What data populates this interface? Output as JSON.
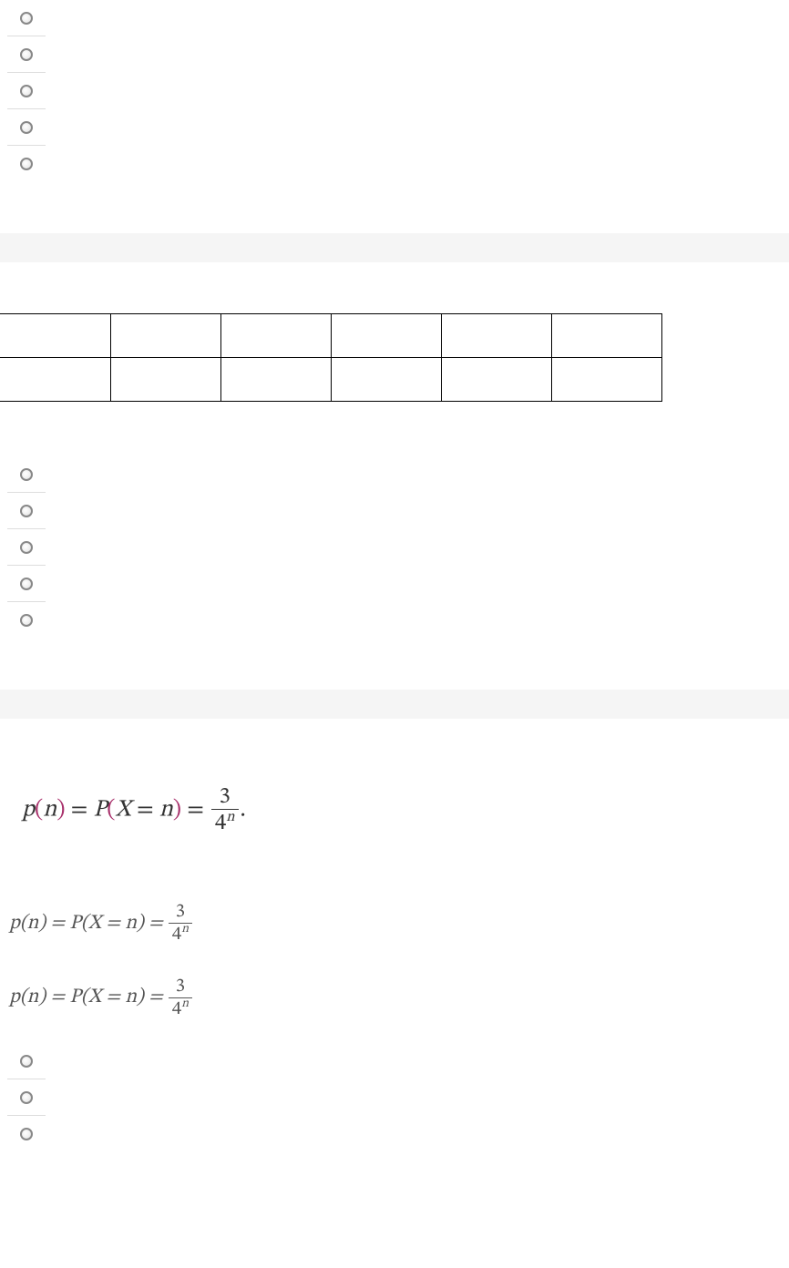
{
  "radio_groups": {
    "g1": [
      {
        "id": "r1"
      },
      {
        "id": "r2"
      },
      {
        "id": "r3"
      },
      {
        "id": "r4"
      },
      {
        "id": "r5"
      }
    ],
    "g2": [
      {
        "id": "r6"
      },
      {
        "id": "r7"
      },
      {
        "id": "r8"
      },
      {
        "id": "r9"
      },
      {
        "id": "r10"
      }
    ],
    "g3": [
      {
        "id": "r11"
      },
      {
        "id": "r12"
      },
      {
        "id": "r13"
      }
    ]
  },
  "table": {
    "rows": [
      {
        "cells": [
          "",
          "",
          "",
          "",
          "",
          ""
        ]
      },
      {
        "cells": [
          "",
          "",
          "",
          "",
          "",
          ""
        ]
      }
    ]
  },
  "math": {
    "primary": {
      "lhs_p": "p",
      "lparen": "(",
      "n": "n",
      "rparen": ")",
      "eq": " = ",
      "capP": "P",
      "lparen2": "(",
      "X": "X",
      "eqn": " = ",
      "n2": "n",
      "rparen2": ")",
      "eq2": " = ",
      "frac_num": "3",
      "frac_den_base": "4",
      "frac_den_exp": "n",
      "dot": "."
    },
    "secondary": {
      "text_plain": "p(n) = P(X = n) = ",
      "frac_num": "3",
      "frac_den_base": "4",
      "frac_den_exp": "n"
    }
  }
}
